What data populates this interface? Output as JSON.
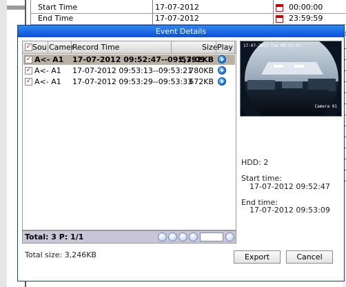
{
  "background": {
    "rows": [
      {
        "label": "Start Time",
        "date": "17-07-2012",
        "time": "00:00:00"
      },
      {
        "label": "End Time",
        "date": "17-07-2012",
        "time": "23:59:59"
      }
    ],
    "edge_letter": "d"
  },
  "dialog": {
    "title": "Event Details",
    "columns": [
      "Sou",
      "Camer",
      "Record Time",
      "Size",
      "Play"
    ],
    "rows": [
      {
        "source": "A<- A1",
        "record_time": "17-07-2012 09:52:47--09:53:09",
        "size": "1,792KB",
        "checked": true,
        "selected": true
      },
      {
        "source": "A<- A1",
        "record_time": "17-07-2012 09:53:13--09:53:21",
        "size": "780KB",
        "checked": true,
        "selected": false
      },
      {
        "source": "A<- A1",
        "record_time": "17-07-2012 09:53:29--09:53:33",
        "size": "672KB",
        "checked": true,
        "selected": false
      }
    ],
    "pager": {
      "total_text": "Total: 3  P: 1/1",
      "page_input": ""
    },
    "preview": {
      "timestamp": "17-07-2012 Tue 09:52:47",
      "camera_label": "Camera 01"
    },
    "details": {
      "hdd": "HDD: 2",
      "start_label": "Start time:",
      "start_value": "17-07-2012 09:52:47",
      "end_label": "End time:",
      "end_value": "17-07-2012 09:53:09"
    },
    "total_size": "Total size: 3,246KB",
    "export_label": "Export",
    "cancel_label": "Cancel"
  },
  "colors": {
    "title_bar": "#1a5fe0",
    "selected_row": "#b9b2a4",
    "pager_bg": "#c9c5d8",
    "check_mark": "#dd0000"
  }
}
